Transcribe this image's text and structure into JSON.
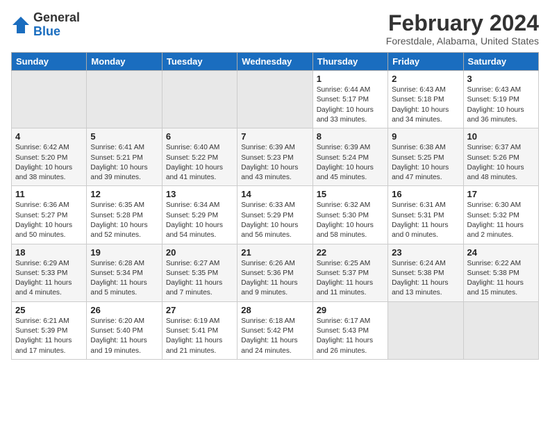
{
  "logo": {
    "general": "General",
    "blue": "Blue"
  },
  "title": "February 2024",
  "subtitle": "Forestdale, Alabama, United States",
  "days_header": [
    "Sunday",
    "Monday",
    "Tuesday",
    "Wednesday",
    "Thursday",
    "Friday",
    "Saturday"
  ],
  "weeks": [
    [
      {
        "day": "",
        "info": ""
      },
      {
        "day": "",
        "info": ""
      },
      {
        "day": "",
        "info": ""
      },
      {
        "day": "",
        "info": ""
      },
      {
        "day": "1",
        "info": "Sunrise: 6:44 AM\nSunset: 5:17 PM\nDaylight: 10 hours\nand 33 minutes."
      },
      {
        "day": "2",
        "info": "Sunrise: 6:43 AM\nSunset: 5:18 PM\nDaylight: 10 hours\nand 34 minutes."
      },
      {
        "day": "3",
        "info": "Sunrise: 6:43 AM\nSunset: 5:19 PM\nDaylight: 10 hours\nand 36 minutes."
      }
    ],
    [
      {
        "day": "4",
        "info": "Sunrise: 6:42 AM\nSunset: 5:20 PM\nDaylight: 10 hours\nand 38 minutes."
      },
      {
        "day": "5",
        "info": "Sunrise: 6:41 AM\nSunset: 5:21 PM\nDaylight: 10 hours\nand 39 minutes."
      },
      {
        "day": "6",
        "info": "Sunrise: 6:40 AM\nSunset: 5:22 PM\nDaylight: 10 hours\nand 41 minutes."
      },
      {
        "day": "7",
        "info": "Sunrise: 6:39 AM\nSunset: 5:23 PM\nDaylight: 10 hours\nand 43 minutes."
      },
      {
        "day": "8",
        "info": "Sunrise: 6:39 AM\nSunset: 5:24 PM\nDaylight: 10 hours\nand 45 minutes."
      },
      {
        "day": "9",
        "info": "Sunrise: 6:38 AM\nSunset: 5:25 PM\nDaylight: 10 hours\nand 47 minutes."
      },
      {
        "day": "10",
        "info": "Sunrise: 6:37 AM\nSunset: 5:26 PM\nDaylight: 10 hours\nand 48 minutes."
      }
    ],
    [
      {
        "day": "11",
        "info": "Sunrise: 6:36 AM\nSunset: 5:27 PM\nDaylight: 10 hours\nand 50 minutes."
      },
      {
        "day": "12",
        "info": "Sunrise: 6:35 AM\nSunset: 5:28 PM\nDaylight: 10 hours\nand 52 minutes."
      },
      {
        "day": "13",
        "info": "Sunrise: 6:34 AM\nSunset: 5:29 PM\nDaylight: 10 hours\nand 54 minutes."
      },
      {
        "day": "14",
        "info": "Sunrise: 6:33 AM\nSunset: 5:29 PM\nDaylight: 10 hours\nand 56 minutes."
      },
      {
        "day": "15",
        "info": "Sunrise: 6:32 AM\nSunset: 5:30 PM\nDaylight: 10 hours\nand 58 minutes."
      },
      {
        "day": "16",
        "info": "Sunrise: 6:31 AM\nSunset: 5:31 PM\nDaylight: 11 hours\nand 0 minutes."
      },
      {
        "day": "17",
        "info": "Sunrise: 6:30 AM\nSunset: 5:32 PM\nDaylight: 11 hours\nand 2 minutes."
      }
    ],
    [
      {
        "day": "18",
        "info": "Sunrise: 6:29 AM\nSunset: 5:33 PM\nDaylight: 11 hours\nand 4 minutes."
      },
      {
        "day": "19",
        "info": "Sunrise: 6:28 AM\nSunset: 5:34 PM\nDaylight: 11 hours\nand 5 minutes."
      },
      {
        "day": "20",
        "info": "Sunrise: 6:27 AM\nSunset: 5:35 PM\nDaylight: 11 hours\nand 7 minutes."
      },
      {
        "day": "21",
        "info": "Sunrise: 6:26 AM\nSunset: 5:36 PM\nDaylight: 11 hours\nand 9 minutes."
      },
      {
        "day": "22",
        "info": "Sunrise: 6:25 AM\nSunset: 5:37 PM\nDaylight: 11 hours\nand 11 minutes."
      },
      {
        "day": "23",
        "info": "Sunrise: 6:24 AM\nSunset: 5:38 PM\nDaylight: 11 hours\nand 13 minutes."
      },
      {
        "day": "24",
        "info": "Sunrise: 6:22 AM\nSunset: 5:38 PM\nDaylight: 11 hours\nand 15 minutes."
      }
    ],
    [
      {
        "day": "25",
        "info": "Sunrise: 6:21 AM\nSunset: 5:39 PM\nDaylight: 11 hours\nand 17 minutes."
      },
      {
        "day": "26",
        "info": "Sunrise: 6:20 AM\nSunset: 5:40 PM\nDaylight: 11 hours\nand 19 minutes."
      },
      {
        "day": "27",
        "info": "Sunrise: 6:19 AM\nSunset: 5:41 PM\nDaylight: 11 hours\nand 21 minutes."
      },
      {
        "day": "28",
        "info": "Sunrise: 6:18 AM\nSunset: 5:42 PM\nDaylight: 11 hours\nand 24 minutes."
      },
      {
        "day": "29",
        "info": "Sunrise: 6:17 AM\nSunset: 5:43 PM\nDaylight: 11 hours\nand 26 minutes."
      },
      {
        "day": "",
        "info": ""
      },
      {
        "day": "",
        "info": ""
      }
    ]
  ]
}
